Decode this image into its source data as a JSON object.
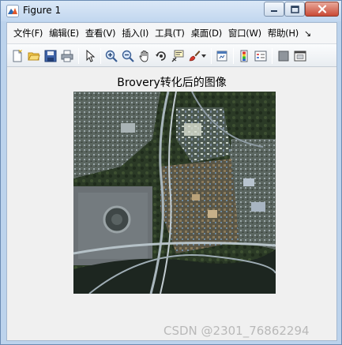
{
  "window": {
    "title": "Figure 1",
    "controls": {
      "minimize_icon": "minimize-icon",
      "maximize_icon": "maximize-icon",
      "close_icon": "close-icon"
    }
  },
  "menubar": {
    "items": [
      {
        "label": "文件(F)"
      },
      {
        "label": "编辑(E)"
      },
      {
        "label": "查看(V)"
      },
      {
        "label": "插入(I)"
      },
      {
        "label": "工具(T)"
      },
      {
        "label": "桌面(D)"
      },
      {
        "label": "窗口(W)"
      },
      {
        "label": "帮助(H)"
      }
    ],
    "overflow_glyph": "↘"
  },
  "toolbar": {
    "icons": [
      "new-figure-icon",
      "open-file-icon",
      "save-icon",
      "print-icon",
      "edit-plot-arrow-icon",
      "zoom-in-icon",
      "zoom-out-icon",
      "pan-hand-icon",
      "rotate-3d-icon",
      "data-cursor-icon",
      "brush-icon",
      "brush-dropdown-icon",
      "link-plot-icon",
      "insert-colorbar-icon",
      "insert-legend-icon",
      "hide-plot-tools-icon",
      "show-plot-tools-icon"
    ]
  },
  "figure": {
    "title": "Brovery转化后的图像",
    "image_description_icon": "satellite-image"
  },
  "watermark": "CSDN @2301_76862294",
  "colors": {
    "titlebar": "#c2d7ef",
    "close_button": "#c94a36",
    "client_bg": "#f0f0f0",
    "image_bg": "#2f3a33"
  }
}
